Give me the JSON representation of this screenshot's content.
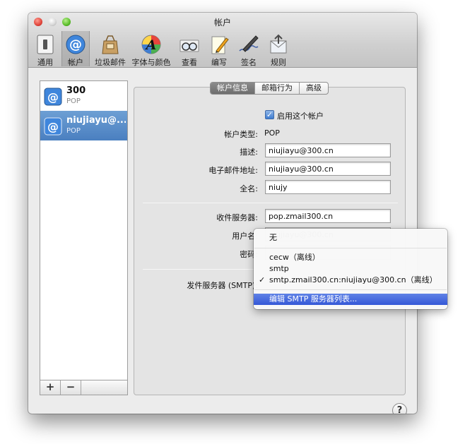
{
  "window": {
    "title": "帐户"
  },
  "toolbar": {
    "items": [
      {
        "label": "通用",
        "icon": "general-switch-icon"
      },
      {
        "label": "帐户",
        "icon": "at-sign-icon"
      },
      {
        "label": "垃圾邮件",
        "icon": "junk-bag-icon"
      },
      {
        "label": "字体与颜色",
        "icon": "font-palette-icon"
      },
      {
        "label": "查看",
        "icon": "glasses-icon"
      },
      {
        "label": "编写",
        "icon": "compose-pencil-icon"
      },
      {
        "label": "签名",
        "icon": "signature-pen-icon"
      },
      {
        "label": "规则",
        "icon": "rules-envelope-icon"
      }
    ],
    "selected": "帐户"
  },
  "accounts": [
    {
      "name": "300",
      "type": "POP"
    },
    {
      "name": "niujiayu@...",
      "type": "POP"
    }
  ],
  "list_footer": {
    "add": "+",
    "remove": "−"
  },
  "tabs": [
    {
      "label": "帐户信息"
    },
    {
      "label": "邮箱行为"
    },
    {
      "label": "高级"
    }
  ],
  "form": {
    "enable_label": "启用这个帐户",
    "enable_checked": true,
    "account_type_label": "帐户类型:",
    "account_type_value": "POP",
    "description_label": "描述:",
    "description_value": "niujiayu@300.cn",
    "email_label": "电子邮件地址:",
    "email_value": "niujiayu@300.cn",
    "fullname_label": "全名:",
    "fullname_value": "niujy",
    "incoming_label": "收件服务器:",
    "incoming_value": "pop.zmail300.cn",
    "username_label": "用户名:",
    "username_value": "niujiayu@300.cn",
    "password_label": "密码:",
    "smtp_label": "发件服务器 (SMTP):"
  },
  "smtp_menu": {
    "none": "无",
    "options": [
      "cecw（离线）",
      "smtp",
      "smtp.zmail300.cn:niujiayu@300.cn（离线）"
    ],
    "checked": "smtp.zmail300.cn:niujiayu@300.cn（离线）",
    "check_mark": "✓",
    "edit": "编辑 SMTP 服务器列表..."
  },
  "help": "?"
}
